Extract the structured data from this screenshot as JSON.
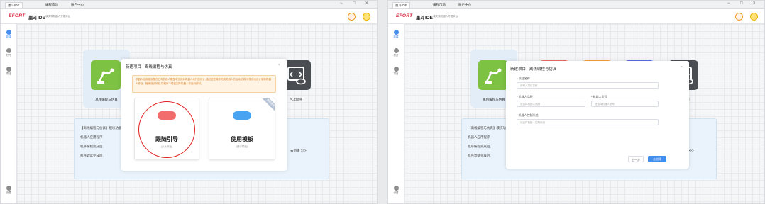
{
  "tabs": [
    "墨斗IDE",
    "编程市场",
    "账户中心"
  ],
  "window_controls": [
    "−",
    "□",
    "×"
  ],
  "header": {
    "logo": "EFORT",
    "title": "墨斗IDE",
    "subtitle": "• 埃夫特机器人开发平台"
  },
  "sidebar": {
    "items": [
      {
        "label": "新建",
        "icon": "plus-icon"
      },
      {
        "label": "打开",
        "icon": "compass-icon"
      },
      {
        "label": "项目",
        "icon": "layers-icon"
      }
    ],
    "settings_label": "设置"
  },
  "project_types": {
    "offline_label": "离线编程与仿真",
    "plc_label": "PLC程序"
  },
  "info": {
    "line1": "【离线编程与仿真】模块功能",
    "line2": "机器人应用程序",
    "line3": "程序编程完成后,",
    "line4": "程序调试完成后,",
    "link": "去创建 >>>"
  },
  "modal1": {
    "title": "新建项目 - 离线编程与仿真",
    "close": "×",
    "warning": "机器人应用程序是在已有机器人模型中完成对机器人动作的设计,通过这些操作完成机器人的运动仿真,可视化地设计实际机器人作业。程序设计好后,将程序下载到实际机器人中运行即可。",
    "choice_guide": {
      "title": "跟随引导",
      "sub": "(从头开始)"
    },
    "choice_template": {
      "title": "使用模板",
      "sub": "(基于模板)",
      "ribbon": "推荐使用"
    }
  },
  "modal2": {
    "title": "新建项目 - 离线编程与仿真",
    "close": "×",
    "fields": {
      "name_label": "* 项目名称",
      "name_placeholder": "请输入项目名称",
      "brand_label": "* 机器人品牌",
      "brand_placeholder": "请选择机器人品牌",
      "model_label": "* 机器人型号",
      "model_placeholder": "请选择机器人型号",
      "control_label": "* 机器人控制系统",
      "control_placeholder": "请选择机器人控制系统"
    },
    "prev_button": "上一步",
    "create_button": "去创建"
  }
}
